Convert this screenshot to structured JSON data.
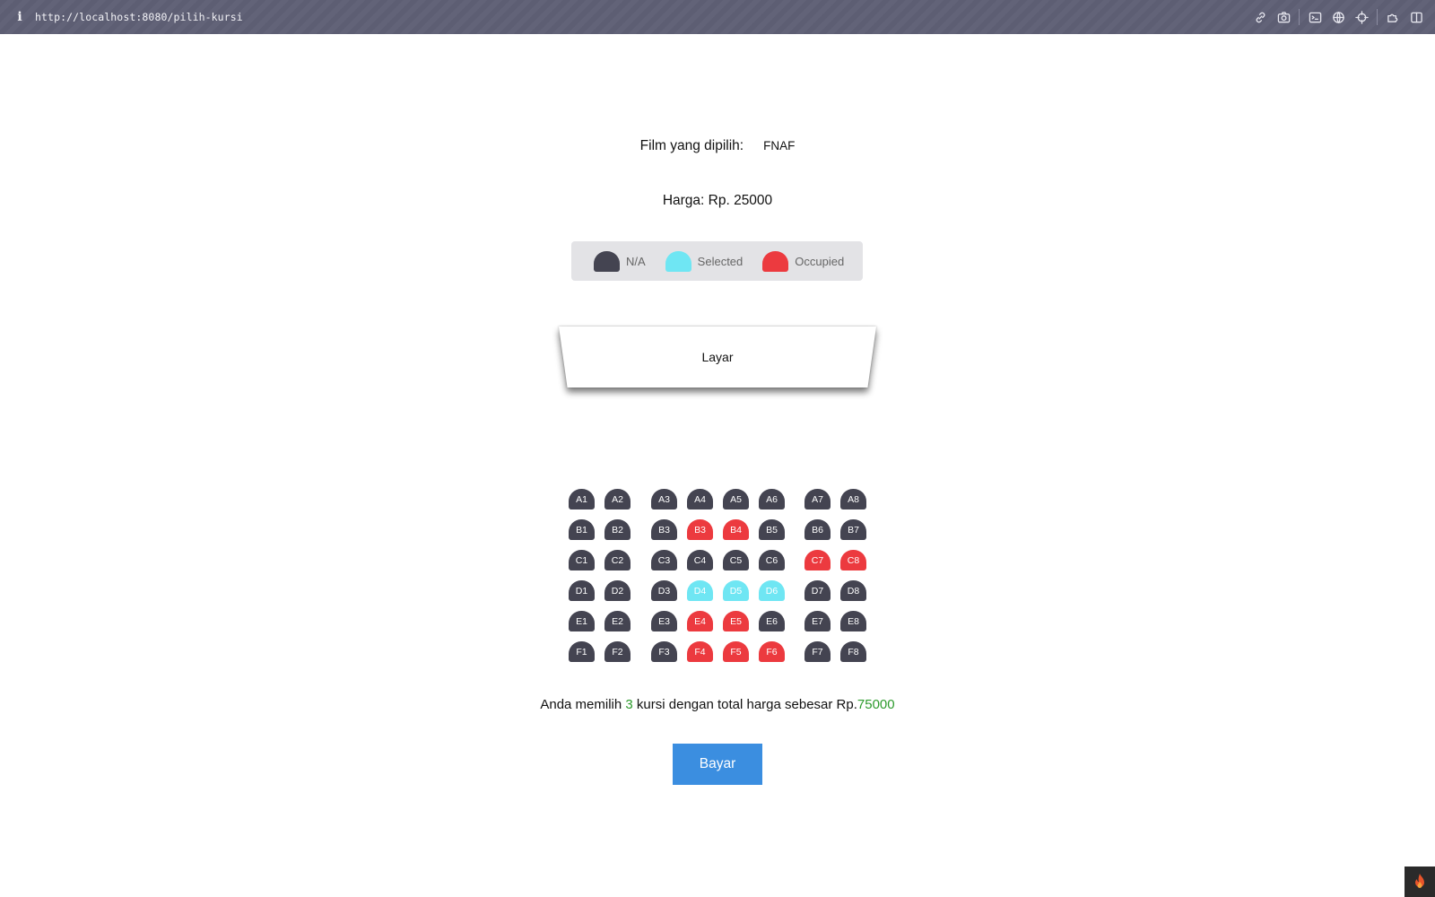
{
  "browser": {
    "url": "http://localhost:8080/pilih-kursi",
    "info_icon": "i"
  },
  "film": {
    "label": "Film yang dipilih:",
    "value": "FNAF"
  },
  "price": {
    "label": "Harga: Rp. 25000"
  },
  "legend": [
    {
      "label": "N/A",
      "color": "#444451"
    },
    {
      "label": "Selected",
      "color": "#6fe6f3"
    },
    {
      "label": "Occupied",
      "color": "#ec3a3f"
    }
  ],
  "screen": {
    "label": "Layar"
  },
  "colors": {
    "na": "#444451",
    "selected": "#6fe6f3",
    "occupied": "#ec3a3f",
    "accent": "#3b8ee0",
    "highlight": "#2d9b2d"
  },
  "seat_rows": [
    {
      "row": "A",
      "seats": [
        {
          "id": "A1",
          "status": "na"
        },
        {
          "id": "A2",
          "status": "na"
        },
        {
          "id": "A3",
          "status": "na"
        },
        {
          "id": "A4",
          "status": "na"
        },
        {
          "id": "A5",
          "status": "na"
        },
        {
          "id": "A6",
          "status": "na"
        },
        {
          "id": "A7",
          "status": "na"
        },
        {
          "id": "A8",
          "status": "na"
        }
      ]
    },
    {
      "row": "B",
      "seats": [
        {
          "id": "B1",
          "status": "na"
        },
        {
          "id": "B2",
          "status": "na"
        },
        {
          "id": "B3",
          "status": "na"
        },
        {
          "id": "B3",
          "status": "occupied"
        },
        {
          "id": "B4",
          "status": "occupied"
        },
        {
          "id": "B5",
          "status": "na"
        },
        {
          "id": "B6",
          "status": "na"
        },
        {
          "id": "B7",
          "status": "na"
        }
      ]
    },
    {
      "row": "C",
      "seats": [
        {
          "id": "C1",
          "status": "na"
        },
        {
          "id": "C2",
          "status": "na"
        },
        {
          "id": "C3",
          "status": "na"
        },
        {
          "id": "C4",
          "status": "na"
        },
        {
          "id": "C5",
          "status": "na"
        },
        {
          "id": "C6",
          "status": "na"
        },
        {
          "id": "C7",
          "status": "occupied"
        },
        {
          "id": "C8",
          "status": "occupied"
        }
      ]
    },
    {
      "row": "D",
      "seats": [
        {
          "id": "D1",
          "status": "na"
        },
        {
          "id": "D2",
          "status": "na"
        },
        {
          "id": "D3",
          "status": "na"
        },
        {
          "id": "D4",
          "status": "selected"
        },
        {
          "id": "D5",
          "status": "selected"
        },
        {
          "id": "D6",
          "status": "selected"
        },
        {
          "id": "D7",
          "status": "na"
        },
        {
          "id": "D8",
          "status": "na"
        }
      ]
    },
    {
      "row": "E",
      "seats": [
        {
          "id": "E1",
          "status": "na"
        },
        {
          "id": "E2",
          "status": "na"
        },
        {
          "id": "E3",
          "status": "na"
        },
        {
          "id": "E4",
          "status": "occupied"
        },
        {
          "id": "E5",
          "status": "occupied"
        },
        {
          "id": "E6",
          "status": "na"
        },
        {
          "id": "E7",
          "status": "na"
        },
        {
          "id": "E8",
          "status": "na"
        }
      ]
    },
    {
      "row": "F",
      "seats": [
        {
          "id": "F1",
          "status": "na"
        },
        {
          "id": "F2",
          "status": "na"
        },
        {
          "id": "F3",
          "status": "na"
        },
        {
          "id": "F4",
          "status": "occupied"
        },
        {
          "id": "F5",
          "status": "occupied"
        },
        {
          "id": "F6",
          "status": "occupied"
        },
        {
          "id": "F7",
          "status": "na"
        },
        {
          "id": "F8",
          "status": "na"
        }
      ]
    }
  ],
  "summary": {
    "prefix": "Anda memilih ",
    "count": "3",
    "middle": " kursi dengan total harga sebesar Rp.",
    "total": "75000"
  },
  "pay_button": {
    "label": "Bayar"
  },
  "toolbar_icons": [
    "link-icon",
    "camera-icon",
    "terminal-icon",
    "globe-icon",
    "crosshair-icon",
    "puzzle-icon",
    "split-view-icon"
  ],
  "corner_icon": "flame-icon"
}
